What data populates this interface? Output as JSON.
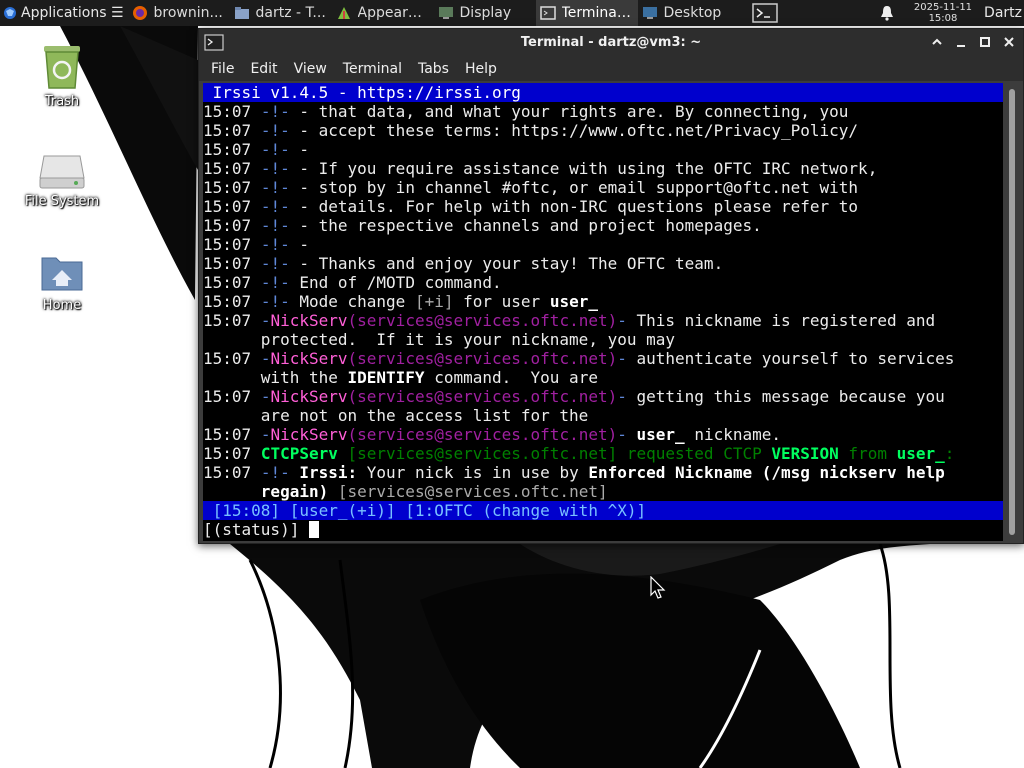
{
  "panel": {
    "applications_label": "Applications ☰",
    "tasks": [
      {
        "label": "brownin...",
        "icon": "firefox-icon"
      },
      {
        "label": "dartz - T...",
        "icon": "folder-icon"
      },
      {
        "label": "Appeara...",
        "icon": "appearance-icon"
      },
      {
        "label": "Display",
        "icon": "display-icon"
      },
      {
        "label": "Terminal...",
        "icon": "terminal-icon",
        "active": true
      },
      {
        "label": "Desktop",
        "icon": "desktop-icon"
      }
    ],
    "clock_date": "2025-11-11",
    "clock_time": "15:08",
    "user": "Dartz"
  },
  "desktop_icons": [
    {
      "label": "Trash",
      "icon": "trash-icon"
    },
    {
      "label": "File System",
      "icon": "drive-icon"
    },
    {
      "label": "Home",
      "icon": "home-folder-icon"
    }
  ],
  "window": {
    "title": "Terminal - dartz@vm3: ~",
    "menu": [
      "File",
      "Edit",
      "View",
      "Terminal",
      "Tabs",
      "Help"
    ]
  },
  "irssi": {
    "topic": " Irssi v1.4.5 - https://irssi.org",
    "ts": "15:07",
    "bang": "-!-",
    "lines": [
      " - that data, and what your rights are. By connecting, you",
      " - accept these terms: https://www.oftc.net/Privacy_Policy/",
      " -",
      " - If you require assistance with using the OFTC IRC network,",
      " - stop by in channel #oftc, or email support@oftc.net with",
      " - details. For help with non-IRC questions please refer to",
      " - the respective channels and project homepages.",
      " -",
      " - Thanks and enjoy your stay! The OFTC team."
    ],
    "end_motd": " End of /MOTD command.",
    "mode_change": " Mode change ",
    "mode_value": "[+i]",
    "for_user": " for user ",
    "user_nick": "user_",
    "nickserv": "NickServ",
    "nickserv_host": "(services@services.oftc.net)",
    "ns_msg1a": " This nickname is registered and",
    "ns_msg1b": "protected.  If it is your nickname, you may",
    "ns_msg2a": " authenticate yourself to services",
    "ns_msg2b_pre": "with the ",
    "ns_msg2b_bold": "IDENTIFY",
    "ns_msg2b_post": " command.  You are",
    "ns_msg3a": " getting this message because you",
    "ns_msg3b": "are not on the access list for the",
    "ns_msg4_nick": "user_",
    "ns_msg4_post": " nickname.",
    "ctcp_serv": "CTCPServ",
    "ctcp_host": "[services@services.oftc.net]",
    "ctcp_requested": " requested CTCP ",
    "ctcp_version": "VERSION",
    "ctcp_from": " from ",
    "ctcp_user": "user_",
    "ctcp_colon": ":",
    "nick_irssi": "Irssi:",
    "nick_msg": " Your nick is in use by ",
    "nick_enforced": "Enforced Nickname (/msg nickserv help",
    "nick_regain": "regain)",
    "nick_host": "[services@services.oftc.net]",
    "statusbar": " [15:08] [user_(+i)] [1:OFTC (change with ^X)]",
    "prompt": "[(status)] "
  }
}
